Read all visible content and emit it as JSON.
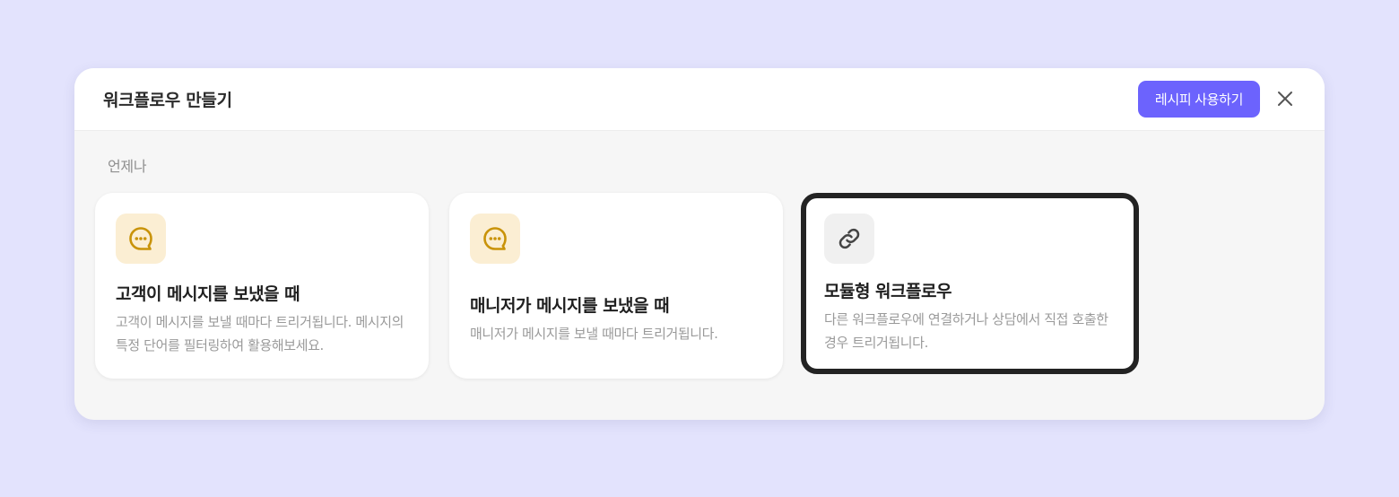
{
  "modal": {
    "title": "워크플로우 만들기",
    "recipe_button_label": "레시피 사용하기",
    "close_icon": "close-icon"
  },
  "section": {
    "label": "언제나"
  },
  "cards": [
    {
      "icon": "chat-bubble-icon",
      "title": "고객이 메시지를 보냈을 때",
      "description": "고객이 메시지를 보낼 때마다 트리거됩니다. 메시지의 특정 단어를 필터링하여 활용해보세요."
    },
    {
      "icon": "chat-bubble-icon",
      "title": "매니저가 메시지를 보냈을 때",
      "description": "매니저가 메시지를 보낼 때마다 트리거됩니다."
    },
    {
      "icon": "link-icon",
      "title": "모듈형 워크플로우",
      "description": "다른 워크플로우에 연결하거나 상담에서 직접 호출한 경우 트리거됩니다."
    }
  ],
  "colors": {
    "page_background": "#e3e3fd",
    "accent": "#6c63fd",
    "chat_icon": "#c99309",
    "chat_icon_background": "#fbeed3",
    "selected_border": "#232323"
  }
}
